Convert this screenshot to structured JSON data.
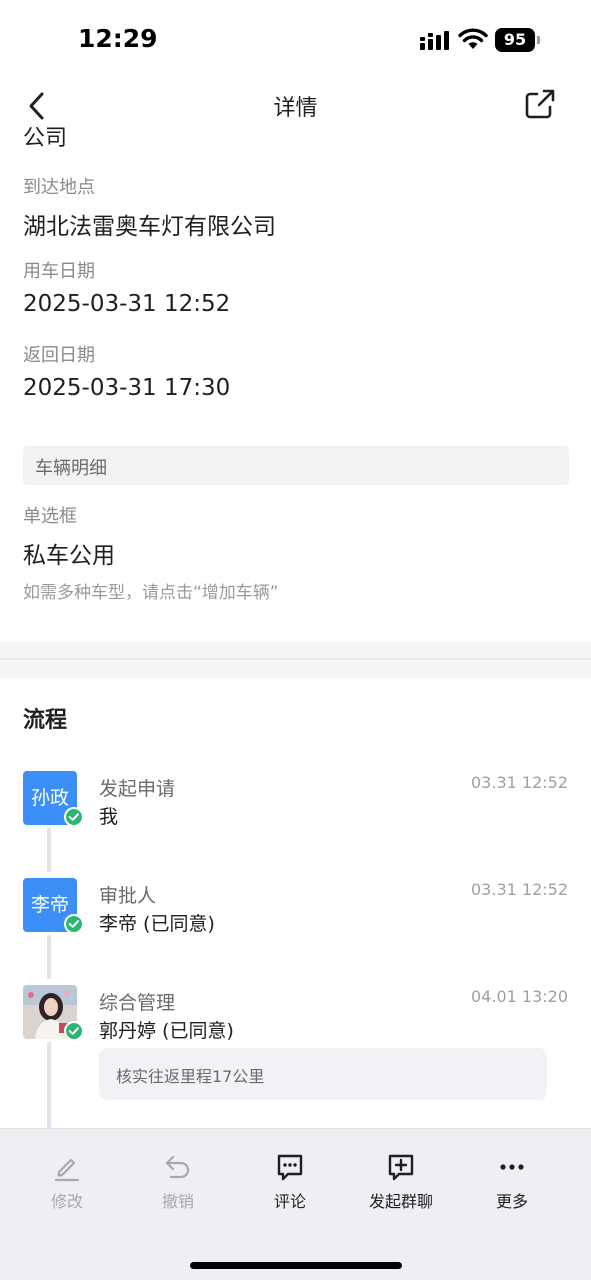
{
  "status_bar": {
    "time": "12:29",
    "battery": "95"
  },
  "nav": {
    "title": "详情"
  },
  "form": {
    "partial_value": "公司",
    "arrival_label": "到达地点",
    "arrival_value": "湖北法雷奥车灯有限公司",
    "use_date_label": "用车日期",
    "use_date_value": "2025-03-31 12:52",
    "return_date_label": "返回日期",
    "return_date_value": "2025-03-31 17:30",
    "vehicle_section": "车辆明细",
    "radio_label": "单选框",
    "radio_value": "私车公用",
    "hint": "如需多种车型，请点击“增加车辆”"
  },
  "process": {
    "title": "流程",
    "steps": [
      {
        "avatar_text": "孙政",
        "label": "发起申请",
        "person": "我",
        "time": "03.31 12:52"
      },
      {
        "avatar_text": "李帝",
        "label": "审批人",
        "person": "李帝 (已同意)",
        "time": "03.31 12:52"
      },
      {
        "avatar_text": "",
        "label": "综合管理",
        "person": "郭丹婷 (已同意)",
        "time": "04.01 13:20",
        "comment": "核实往返里程17公里"
      }
    ]
  },
  "toolbar": {
    "items": [
      {
        "label": "修改",
        "icon": "edit-icon",
        "enabled": false
      },
      {
        "label": "撤销",
        "icon": "undo-icon",
        "enabled": false
      },
      {
        "label": "评论",
        "icon": "comment-icon",
        "enabled": true
      },
      {
        "label": "发起群聊",
        "icon": "group-chat-icon",
        "enabled": true
      },
      {
        "label": "更多",
        "icon": "more-icon",
        "enabled": true
      }
    ]
  },
  "colors": {
    "avatar_blue": "#3b8ff6",
    "approved_green": "#2bb673",
    "toolbar_bg": "#efeff3"
  }
}
